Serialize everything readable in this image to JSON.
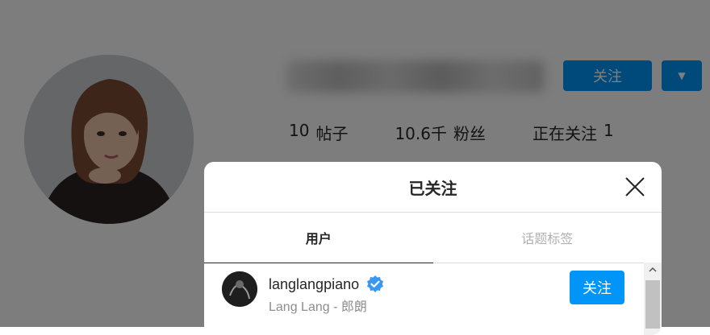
{
  "profile": {
    "follow_label": "关注",
    "stats": [
      {
        "value": "10",
        "label": "帖子"
      },
      {
        "value": "10.6千",
        "label": "粉丝"
      },
      {
        "label": "正在关注",
        "value": "1"
      }
    ]
  },
  "modal": {
    "title": "已关注",
    "tabs": [
      {
        "label": "用户"
      },
      {
        "label": "话题标签"
      }
    ],
    "users": [
      {
        "username": "langlangpiano",
        "full_name": "Lang Lang - 郎朗",
        "verified": true,
        "follow_label": "关注"
      }
    ]
  },
  "colors": {
    "accent": "#0095f6",
    "overlay": "rgba(0,0,0,0.5)"
  }
}
